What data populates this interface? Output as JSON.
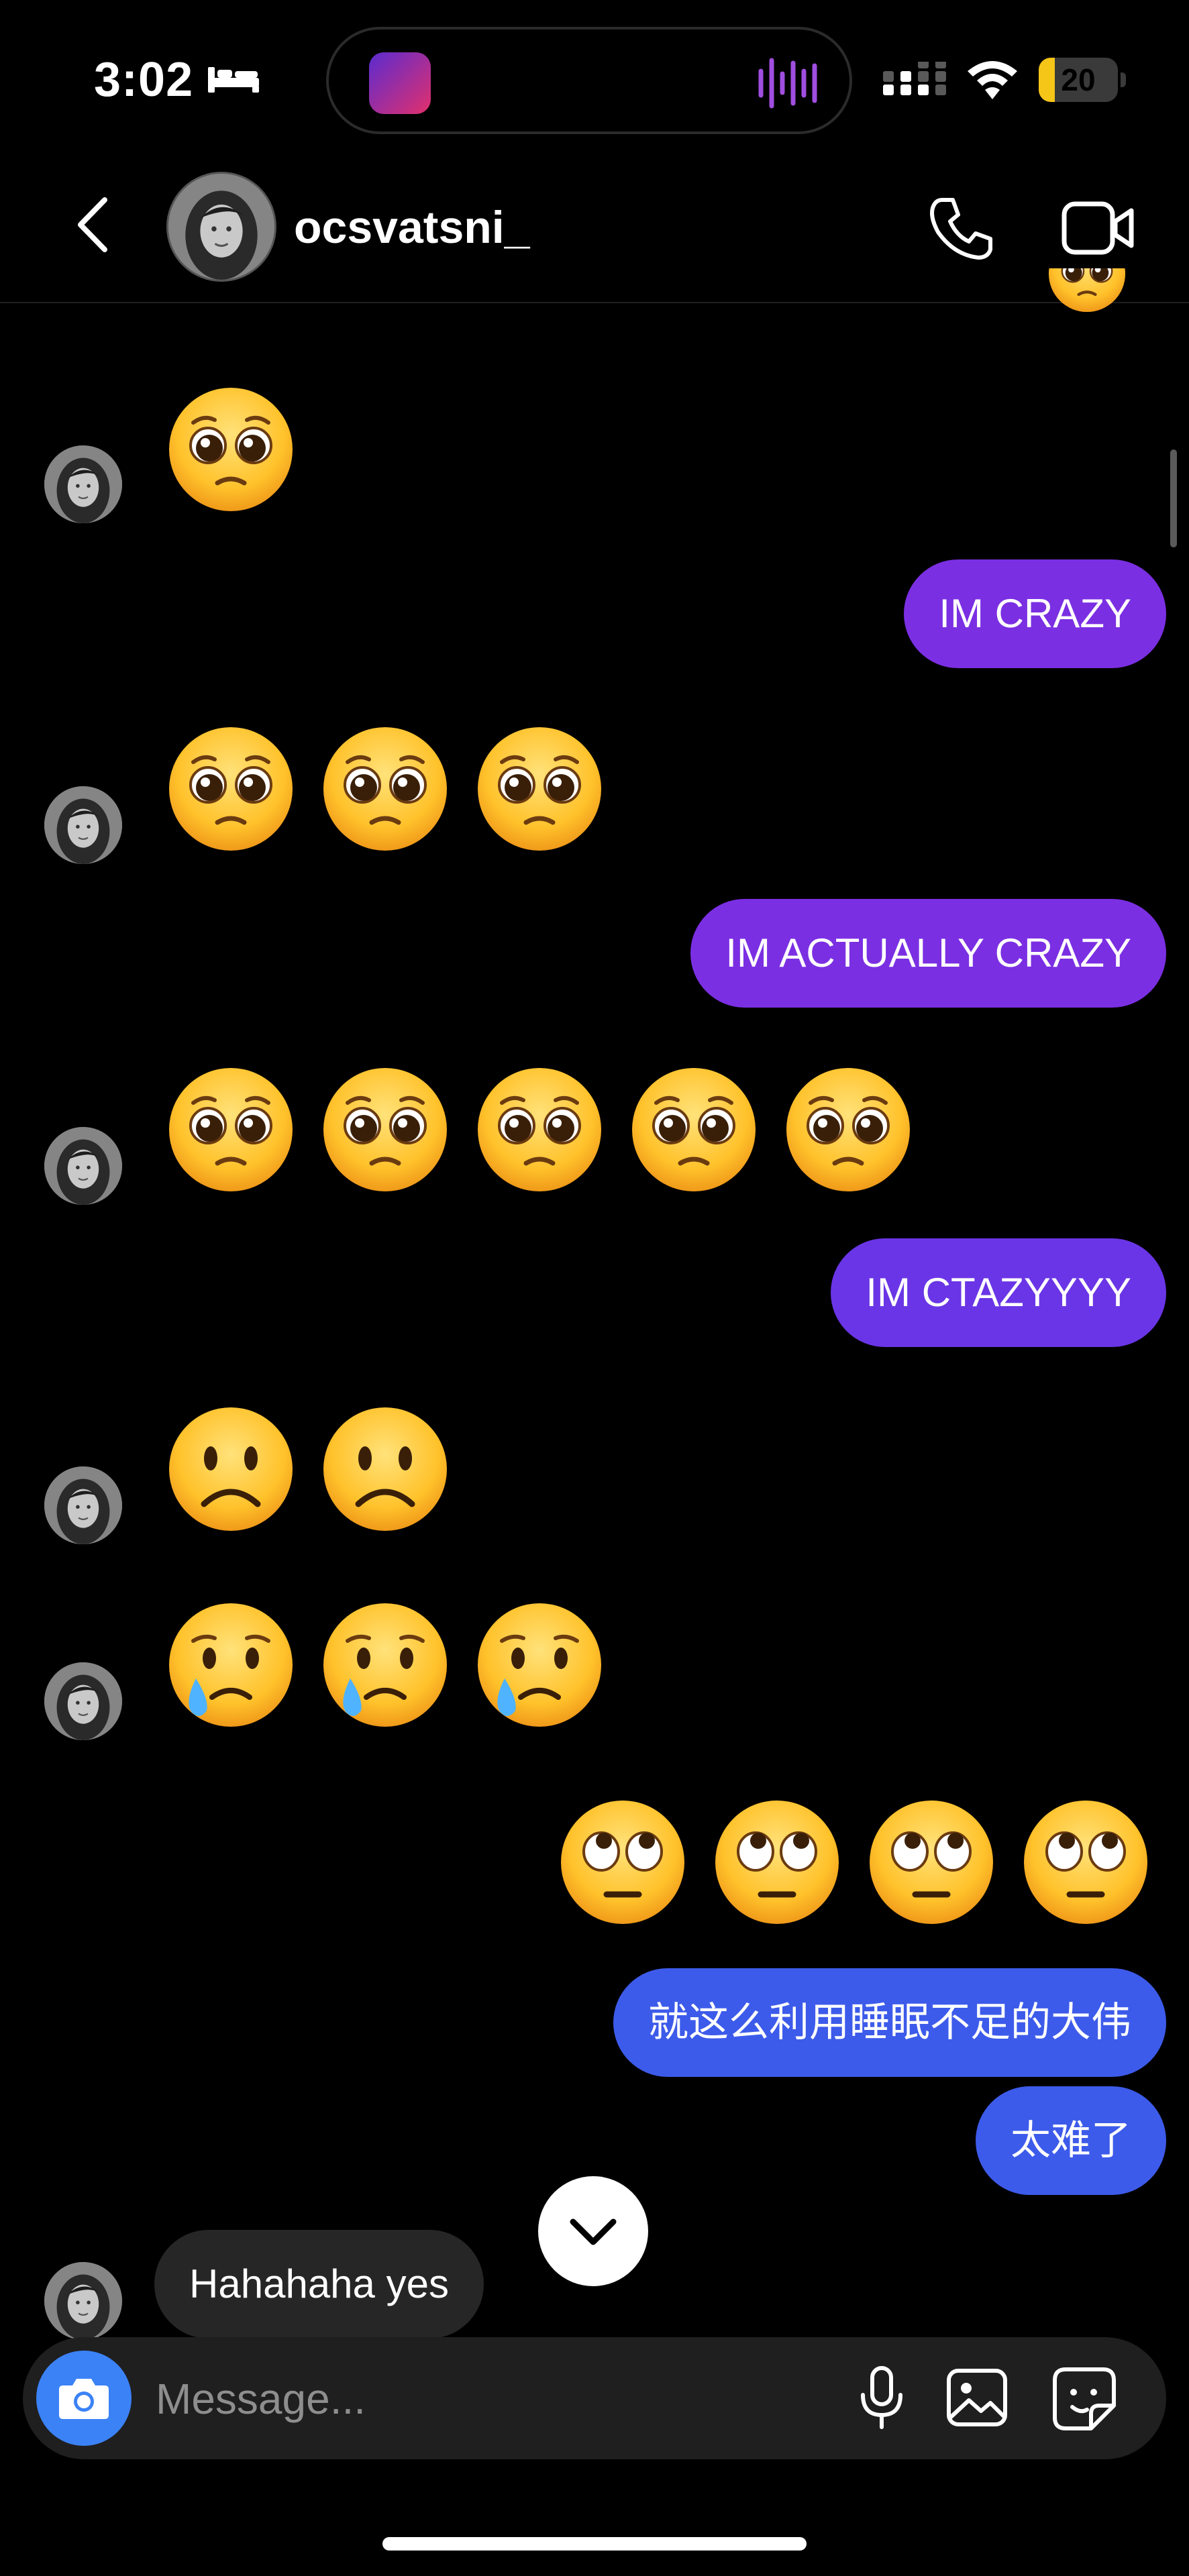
{
  "status": {
    "time": "3:02",
    "battery": "20",
    "battery_pct": 20
  },
  "header": {
    "username": "ocsvatsni_"
  },
  "messages": {
    "m1": "🥺",
    "m2": "IM CRAZY",
    "m3": "🥺🥺🥺",
    "m4": "IM ACTUALLY CRAZY",
    "m5": "🥺🥺🥺🥺🥺",
    "m6": "IM CTAZYYYY",
    "m7": "☹️☹️",
    "m8": "😢😢😢",
    "m9": "🙄🙄🙄🙄",
    "m10": "就这么利用睡眠不足的大伟",
    "m11": "太难了",
    "m12": "Hahahaha yes"
  },
  "composer": {
    "placeholder": "Message..."
  },
  "colors": {
    "sent_purple": "#7b2fe3",
    "sent_violet": "#6a35e6",
    "sent_blue": "#3d5bea",
    "received_gray": "#262626",
    "camera_blue": "#3b82f6",
    "battery_yellow": "#f5c518"
  },
  "icons": [
    "bed-icon",
    "signal-icon",
    "wifi-icon",
    "battery-icon",
    "back-arrow-icon",
    "phone-icon",
    "video-camera-icon",
    "chevron-down-icon",
    "camera-icon",
    "microphone-icon",
    "image-icon",
    "sticker-icon"
  ]
}
